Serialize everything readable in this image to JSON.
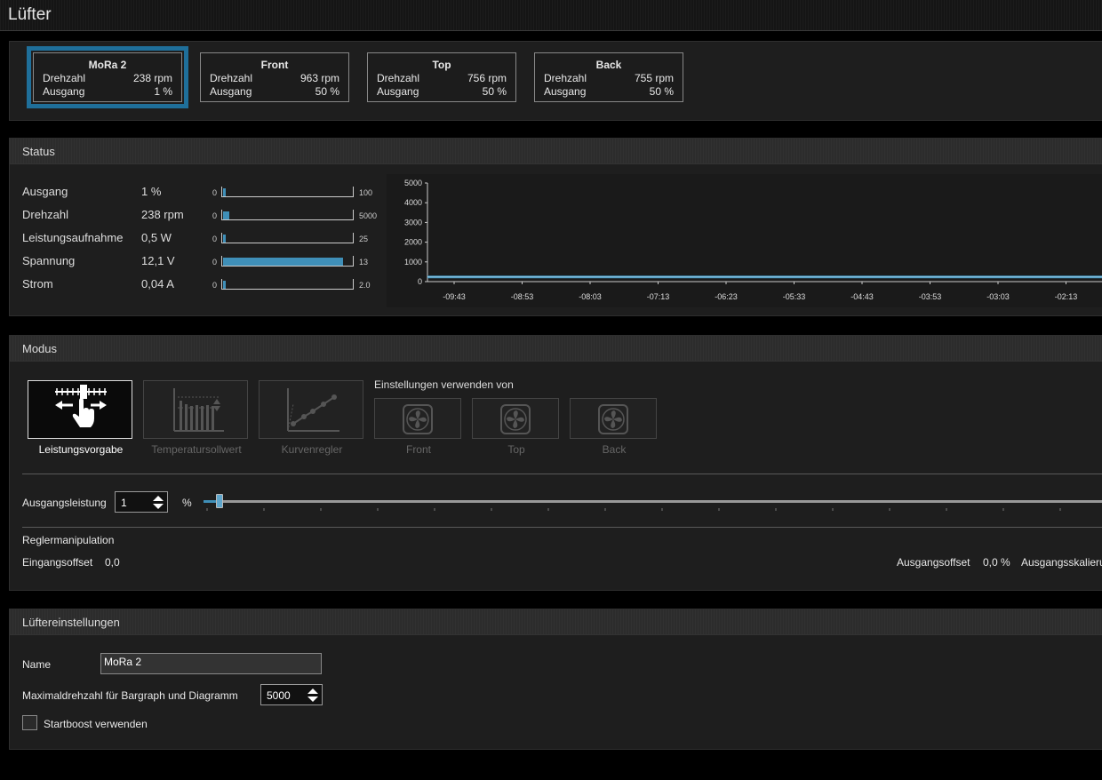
{
  "window": {
    "title": "Lüfter"
  },
  "fans": [
    {
      "name": "MoRa 2",
      "drehzahl_label": "Drehzahl",
      "drehzahl": "238 rpm",
      "ausgang_label": "Ausgang",
      "ausgang": "1 %",
      "selected": true
    },
    {
      "name": "Front",
      "drehzahl_label": "Drehzahl",
      "drehzahl": "963 rpm",
      "ausgang_label": "Ausgang",
      "ausgang": "50 %",
      "selected": false
    },
    {
      "name": "Top",
      "drehzahl_label": "Drehzahl",
      "drehzahl": "756 rpm",
      "ausgang_label": "Ausgang",
      "ausgang": "50 %",
      "selected": false
    },
    {
      "name": "Back",
      "drehzahl_label": "Drehzahl",
      "drehzahl": "755 rpm",
      "ausgang_label": "Ausgang",
      "ausgang": "50 %",
      "selected": false
    }
  ],
  "status": {
    "title": "Status",
    "rows": [
      {
        "label": "Ausgang",
        "value": "1 %",
        "min": "0",
        "max": "100",
        "fill": 0.01
      },
      {
        "label": "Drehzahl",
        "value": "238 rpm",
        "min": "0",
        "max": "5000",
        "fill": 0.048
      },
      {
        "label": "Leistungsaufnahme",
        "value": "0,5 W",
        "min": "0",
        "max": "25",
        "fill": 0.02
      },
      {
        "label": "Spannung",
        "value": "12,1 V",
        "min": "0",
        "max": "13",
        "fill": 0.93
      },
      {
        "label": "Strom",
        "value": "0,04 A",
        "min": "0",
        "max": "2.0",
        "fill": 0.02
      }
    ]
  },
  "chart_data": {
    "type": "line",
    "title": "",
    "xlabel": "",
    "ylabel": "",
    "ylim": [
      0,
      5000
    ],
    "yticks": [
      "5000",
      "4000",
      "3000",
      "2000",
      "1000",
      "0"
    ],
    "xticks": [
      "-09:43",
      "-08:53",
      "-08:03",
      "-07:13",
      "-06:23",
      "-05:33",
      "-04:43",
      "-03:53",
      "-03:03",
      "-02:13"
    ],
    "series": [
      {
        "values": [
          238,
          238,
          238,
          238,
          238,
          238,
          238,
          238,
          238,
          238
        ],
        "color": "#3f8fb8"
      }
    ]
  },
  "modus": {
    "title": "Modus",
    "modes": [
      {
        "label": "Leistungsvorgabe",
        "active": true
      },
      {
        "label": "Temperatursollwert",
        "active": false
      },
      {
        "label": "Kurvenregler",
        "active": false
      }
    ],
    "source_label": "Einstellungen verwenden von",
    "sources": [
      "Front",
      "Top",
      "Back"
    ],
    "output_label": "Ausgangsleistung",
    "output_value": "1",
    "output_unit": "%",
    "slider_value_percent": 1,
    "manip_title": "Reglermanipulation",
    "input_offset_label": "Eingangsoffset",
    "input_offset_value": "0,0",
    "output_offset_label": "Ausgangsoffset",
    "output_offset_value": "0,0 %",
    "output_scale_label": "Ausgangsskalieru"
  },
  "fan_settings": {
    "title": "Lüftereinstellungen",
    "name_label": "Name",
    "name_value": "MoRa 2",
    "maxrpm_label": "Maximaldrehzahl für Bargraph und Diagramm",
    "maxrpm_value": "5000",
    "startboost_label": "Startboost verwenden",
    "startboost_checked": false
  },
  "colors": {
    "accent": "#3f8fb8",
    "selected_border": "#1f6f9a"
  }
}
